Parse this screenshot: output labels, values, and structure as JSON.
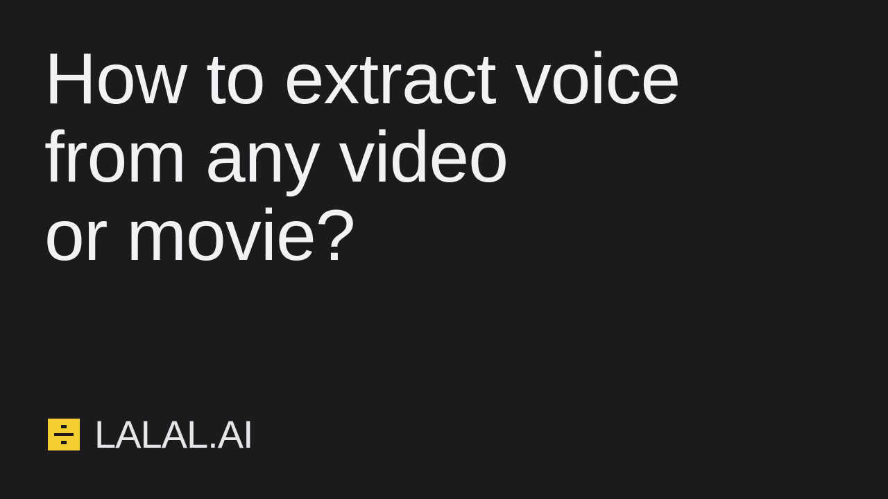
{
  "title": {
    "line1": "How to extract voice",
    "line2": "from any video",
    "line3": "or movie?"
  },
  "brand": {
    "name": "LALAL.AI",
    "icon": "divide-icon",
    "accent_color": "#f4cf32"
  },
  "background_color": "#1c1a1d"
}
